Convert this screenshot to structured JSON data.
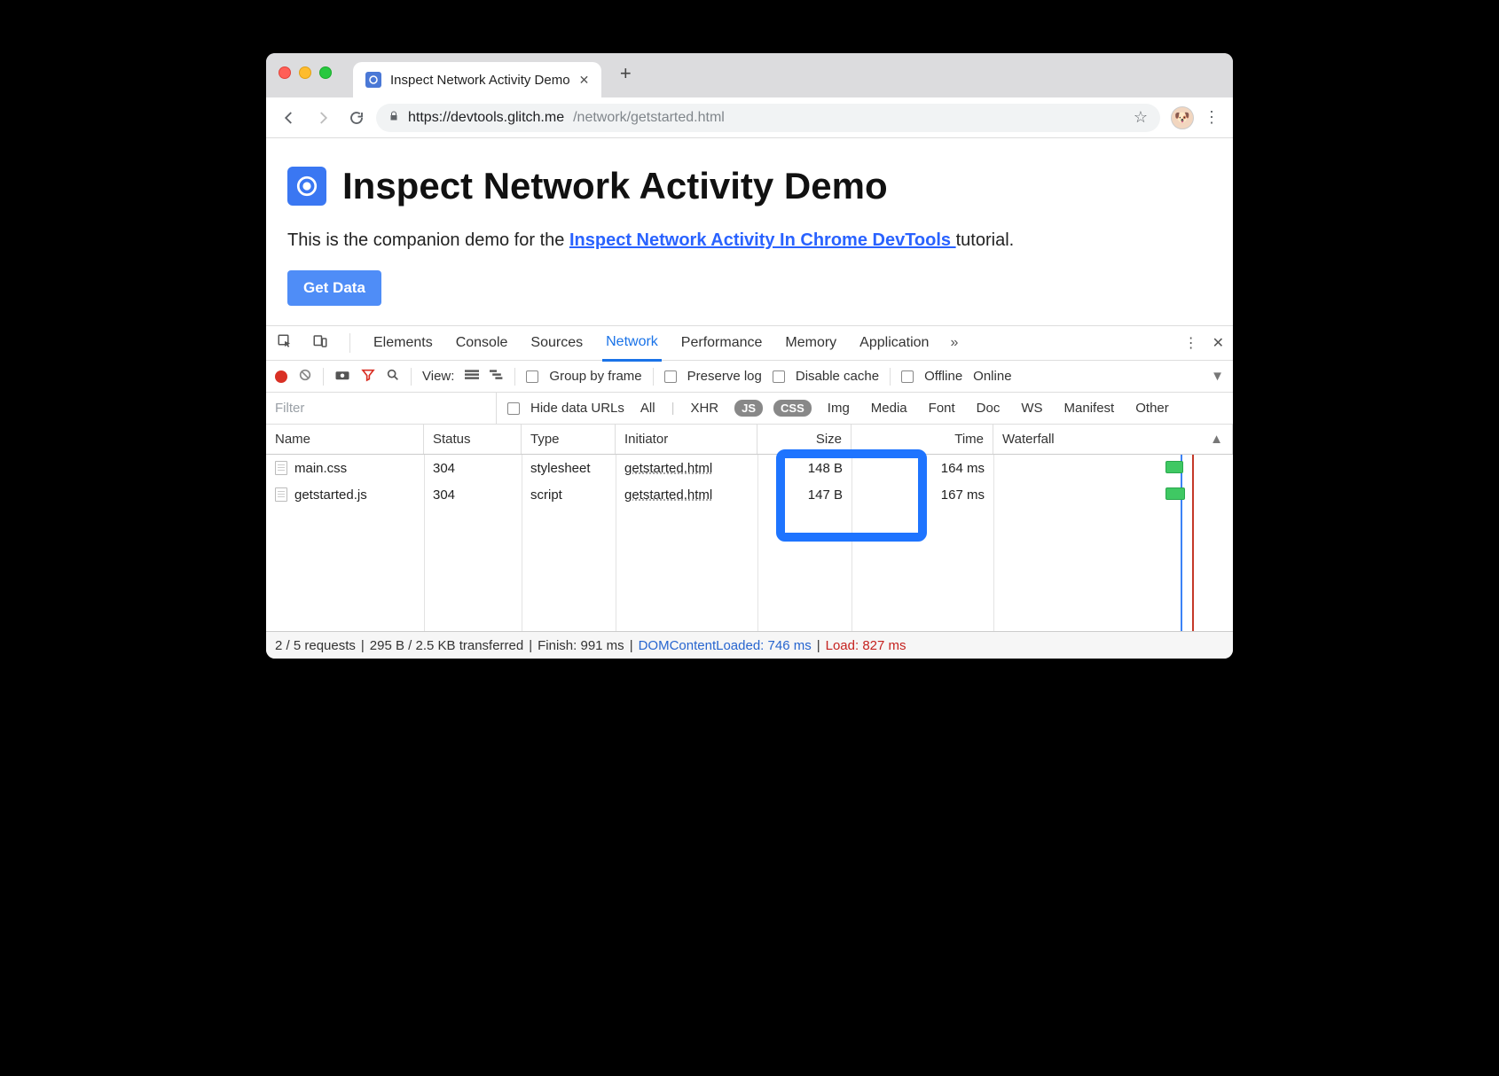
{
  "browser": {
    "tab_title": "Inspect Network Activity Demo",
    "url_secure_domain": "https://devtools.glitch.me",
    "url_path": "/network/getstarted.html"
  },
  "page": {
    "heading": "Inspect Network Activity Demo",
    "intro_pre": "This is the companion demo for the ",
    "intro_link": "Inspect Network Activity In Chrome DevTools ",
    "intro_post": "tutorial.",
    "button_label": "Get Data"
  },
  "devtools": {
    "tabs": {
      "elements": "Elements",
      "console": "Console",
      "sources": "Sources",
      "network": "Network",
      "performance": "Performance",
      "memory": "Memory",
      "application": "Application"
    },
    "network_toolbar": {
      "view_label": "View:",
      "group_by_frame": "Group by frame",
      "preserve_log": "Preserve log",
      "disable_cache": "Disable cache",
      "offline": "Offline",
      "online": "Online"
    },
    "filter": {
      "placeholder": "Filter",
      "hide_data_urls": "Hide data URLs",
      "types": {
        "all": "All",
        "xhr": "XHR",
        "js": "JS",
        "css": "CSS",
        "img": "Img",
        "media": "Media",
        "font": "Font",
        "doc": "Doc",
        "ws": "WS",
        "manifest": "Manifest",
        "other": "Other"
      }
    },
    "columns": {
      "name": "Name",
      "status": "Status",
      "type": "Type",
      "initiator": "Initiator",
      "size": "Size",
      "time": "Time",
      "waterfall": "Waterfall"
    },
    "requests": [
      {
        "name": "main.css",
        "status": "304",
        "type": "stylesheet",
        "initiator": "getstarted.html",
        "size": "148 B",
        "time": "164 ms"
      },
      {
        "name": "getstarted.js",
        "status": "304",
        "type": "script",
        "initiator": "getstarted.html",
        "size": "147 B",
        "time": "167 ms"
      }
    ],
    "status_bar": {
      "requests": "2 / 5 requests",
      "transferred": "295 B / 2.5 KB transferred",
      "finish": "Finish: 991 ms",
      "dcl": "DOMContentLoaded: 746 ms",
      "load": "Load: 827 ms"
    }
  }
}
